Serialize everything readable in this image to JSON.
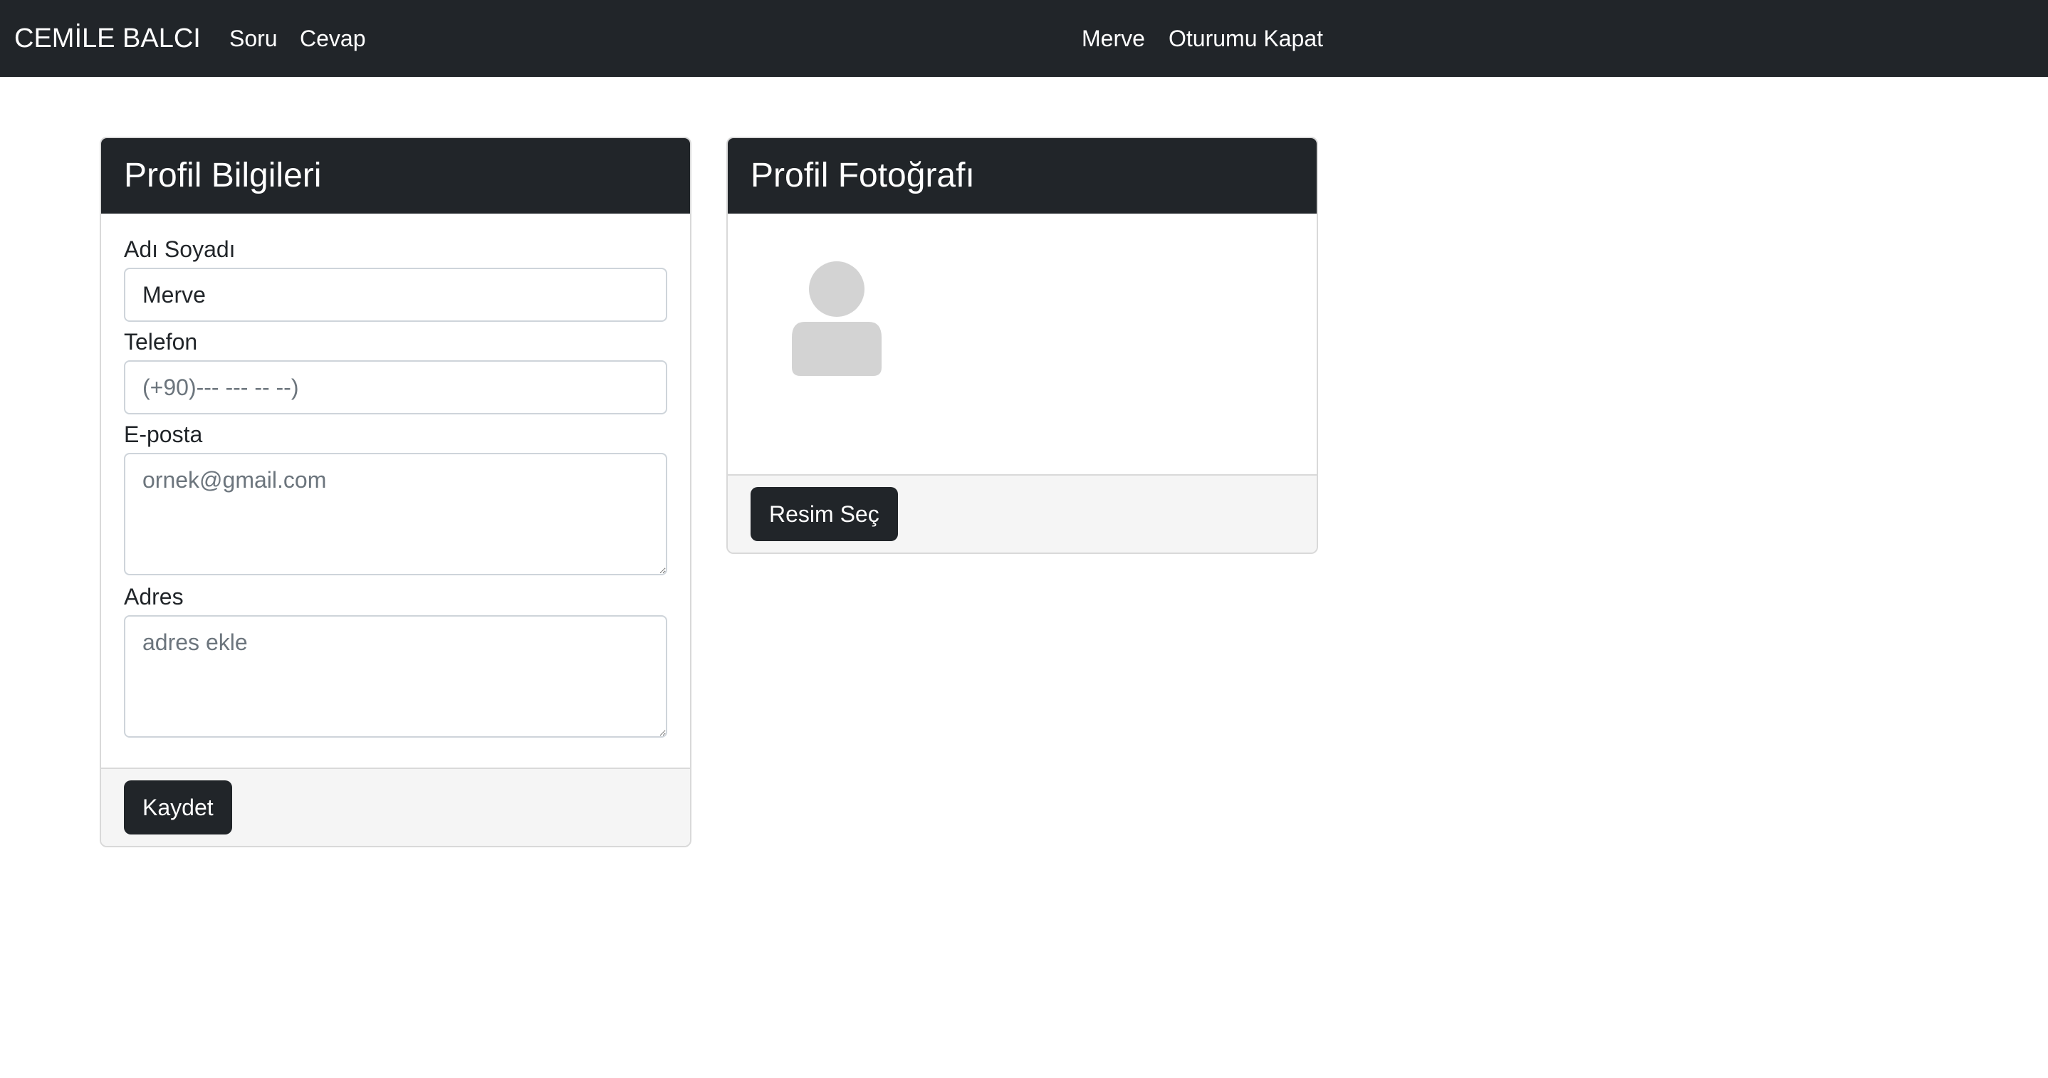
{
  "navbar": {
    "brand": "CEMİLE BALCI",
    "links": [
      "Soru",
      "Cevap"
    ],
    "user_name": "Merve",
    "logout_label": "Oturumu Kapat"
  },
  "profile_info": {
    "title": "Profil Bilgileri",
    "name_label": "Adı Soyadı",
    "name_value": "Merve",
    "phone_label": "Telefon",
    "phone_placeholder": "(+90)--- --- -- --)",
    "email_label": "E-posta",
    "email_placeholder": "ornek@gmail.com",
    "address_label": "Adres",
    "address_placeholder": "adres ekle",
    "save_button": "Kaydet"
  },
  "profile_photo": {
    "title": "Profil Fotoğrafı",
    "avatar_icon": "user-silhouette-icon",
    "select_button": "Resim Seç"
  },
  "colors": {
    "dark": "#212529",
    "placeholder_avatar": "#d3d3d3",
    "footer_bg": "#f5f5f5"
  }
}
